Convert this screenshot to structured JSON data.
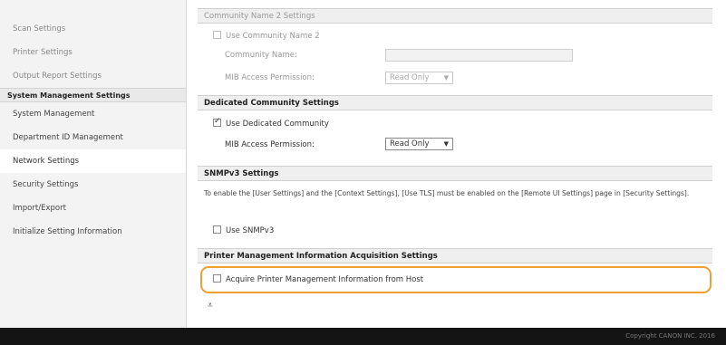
{
  "sidebar": {
    "items_top": [
      {
        "label": "Scan Settings"
      },
      {
        "label": "Printer Settings"
      },
      {
        "label": "Output Report Settings"
      }
    ],
    "section_header": "System Management Settings",
    "items": [
      {
        "label": "System Management"
      },
      {
        "label": "Department ID Management"
      },
      {
        "label": "Network Settings"
      },
      {
        "label": "Security Settings"
      },
      {
        "label": "Import/Export"
      },
      {
        "label": "Initialize Setting Information"
      }
    ]
  },
  "community2": {
    "header": "Community Name 2 Settings",
    "use_label": "Use Community Name 2",
    "name_label": "Community Name:",
    "name_value": "",
    "mib_label": "MIB Access Permission:",
    "mib_value": "Read Only"
  },
  "dedicated": {
    "header": "Dedicated Community Settings",
    "use_label": "Use Dedicated Community",
    "mib_label": "MIB Access Permission:",
    "mib_value": "Read Only"
  },
  "snmpv3": {
    "header": "SNMPv3 Settings",
    "note": "To enable the [User Settings] and the [Context Settings], [Use TLS] must be enabled on the [Remote UI Settings] page in [Security Settings].",
    "use_label": "Use SNMPv3"
  },
  "printer_mgmt": {
    "header": "Printer Management Information Acquisition Settings",
    "acquire_label": "Acquire Printer Management Information from Host"
  },
  "scroll_top_icon": "⩡",
  "footer": {
    "copyright": "Copyright CANON INC. 2016"
  },
  "colors": {
    "highlight": "#f0a030",
    "footer": "#141414"
  }
}
